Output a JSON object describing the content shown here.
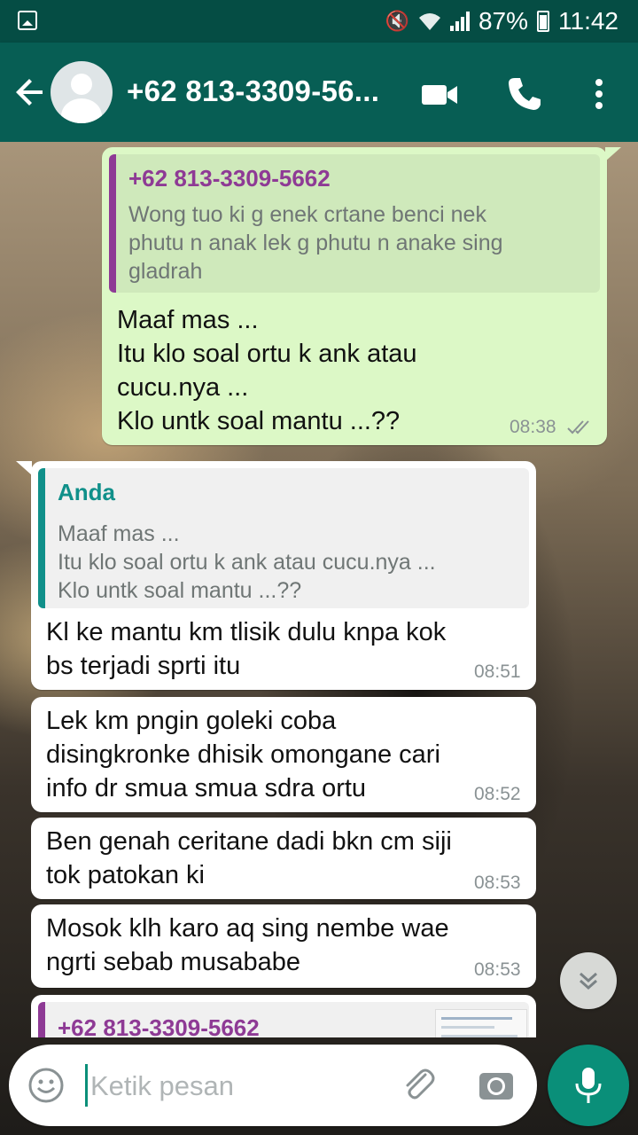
{
  "status_bar": {
    "battery": "87%",
    "time": "11:42",
    "icons": [
      "image-icon",
      "mute-icon",
      "wifi-icon",
      "signal-icon",
      "battery-icon"
    ]
  },
  "header": {
    "contact_name": "+62 813-3309-56...",
    "icons": [
      "back-arrow-icon",
      "avatar",
      "video-call-icon",
      "phone-icon",
      "more-vert-icon"
    ]
  },
  "messages": [
    {
      "direction": "out",
      "quote": {
        "author": "+62 813-3309-5662",
        "lines": [
          "Wong tuo ki g enek crtane benci nek",
          "phutu n anak lek g phutu n anake sing",
          "gladrah"
        ]
      },
      "lines": [
        "Maaf mas ...",
        "Itu klo soal ortu k ank atau",
        "cucu.nya ...",
        "Klo untk soal mantu ...??"
      ],
      "time": "08:38"
    },
    {
      "direction": "in",
      "quote": {
        "author": "Anda",
        "lines": [
          "Maaf mas ...",
          "Itu klo soal ortu k ank atau cucu.nya ...",
          "Klo untk soal mantu ...??"
        ]
      },
      "lines": [
        "Kl ke mantu km tlisik dulu knpa kok",
        "bs terjadi sprti itu"
      ],
      "time": "08:51"
    },
    {
      "direction": "in",
      "lines": [
        "Lek km pngin goleki coba",
        "disingkronke dhisik omongane cari",
        "info dr smua smua sdra ortu"
      ],
      "time": "08:52"
    },
    {
      "direction": "in",
      "lines": [
        "Ben genah ceritane dadi bkn cm siji",
        "tok patokan ki"
      ],
      "time": "08:53"
    },
    {
      "direction": "in",
      "lines": [
        "Mosok klh karo aq sing nembe wae",
        "ngrti sebab musababe"
      ],
      "time": "08:53"
    },
    {
      "direction": "in",
      "quote": {
        "author": "+62 813-3309-5662"
      }
    }
  ],
  "input": {
    "placeholder": "Ketik pesan"
  },
  "colors": {
    "status_bar": "#054d44",
    "header": "#075e54",
    "outgoing_bubble": "#dcf8c6",
    "incoming_bubble": "#ffffff",
    "quote_author_purple": "#8e3a95",
    "quote_author_teal": "#10908a",
    "accent": "#0a8f79"
  }
}
